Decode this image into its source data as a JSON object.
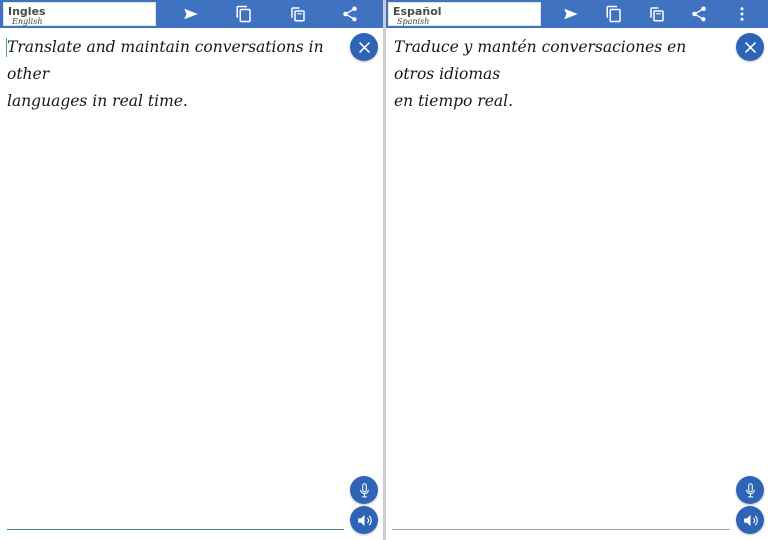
{
  "left_panel": {
    "language": "Ingles",
    "language_sub": "English",
    "text_line1": "Translate and maintain conversations in other",
    "text_line2": "languages in real time."
  },
  "right_panel": {
    "language": "Español",
    "language_sub": "Spanish",
    "text_line1": "Traduce y mantén conversaciones en otros idiomas",
    "text_line2": "en tiempo real."
  },
  "icons": {
    "send": "send-icon",
    "copy": "copy-icon",
    "paste": "paste-icon",
    "share": "share-icon",
    "more": "more-vert-icon",
    "clear": "close-icon",
    "mic": "microphone-icon",
    "speak": "speaker-icon"
  },
  "colors": {
    "toolbar": "#3f72c0",
    "button": "#2e64b6",
    "left_underline": "#3d8a85",
    "right_underline": "#9aa3ad"
  }
}
